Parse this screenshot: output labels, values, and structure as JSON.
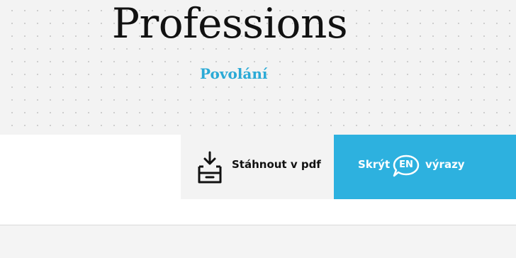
{
  "header": {
    "title": "Professions",
    "subtitle": "Povolání"
  },
  "actions": {
    "download_pdf": {
      "label": "Stáhnout v pdf",
      "icon": "download-tray-icon"
    },
    "hide_english": {
      "label_before": "Skrýt",
      "badge": "EN",
      "label_after": "výrazy",
      "icon": "speech-bubble-icon"
    }
  },
  "colors": {
    "accent": "#2db1df",
    "subtitle": "#2baad6",
    "hero_background": "#f3f3f3",
    "text": "#111111"
  }
}
